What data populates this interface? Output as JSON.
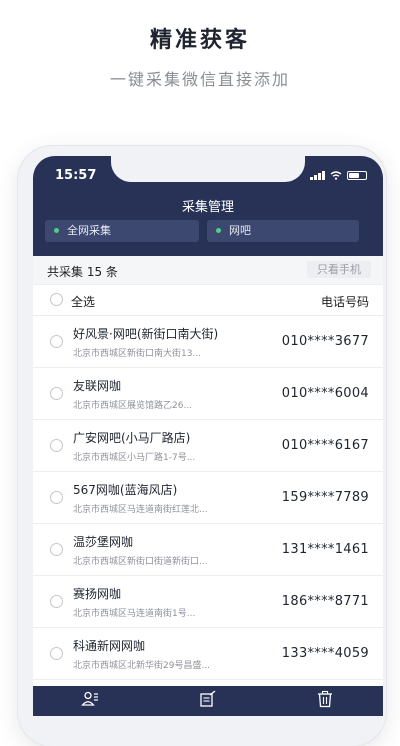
{
  "promo": {
    "title": "精准获客",
    "subtitle": "一键采集微信直接添加"
  },
  "status_bar": {
    "time": "15:57"
  },
  "header": {
    "title": "采集管理"
  },
  "filters": {
    "scope": "全网采集",
    "category": "网吧"
  },
  "summary": {
    "count_text": "共采集 15 条",
    "phone_only_label": "只看手机"
  },
  "list_header": {
    "select_all": "全选",
    "phone_column": "电话号码"
  },
  "records": [
    {
      "name": "好风景·网吧(新街口南大街)",
      "address": "北京市西城区新街口南大街13...",
      "phone": "010****3677"
    },
    {
      "name": "友联网咖",
      "address": "北京市西城区展览馆路乙26...",
      "phone": "010****6004"
    },
    {
      "name": "广安网吧(小马厂路店)",
      "address": "北京市西城区小马厂路1-7号...",
      "phone": "010****6167"
    },
    {
      "name": "567网咖(蓝海风店)",
      "address": "北京市西城区马连道南街红莲北...",
      "phone": "159****7789"
    },
    {
      "name": "温莎堡网咖",
      "address": "北京市西城区新街口街道新街口...",
      "phone": "131****1461"
    },
    {
      "name": "赛扬网咖",
      "address": "北京市西城区马连道南街1号...",
      "phone": "186****8771"
    },
    {
      "name": "科通新网网咖",
      "address": "北京市西城区北新华街29号昌盛...",
      "phone": "133****4059"
    }
  ],
  "colors": {
    "header_bg": "#273256",
    "filter_bg": "#3c4870",
    "active_dot": "#4cd08a"
  },
  "bottom_icons": [
    "user-list-icon",
    "edit-export-icon",
    "trash-icon"
  ]
}
